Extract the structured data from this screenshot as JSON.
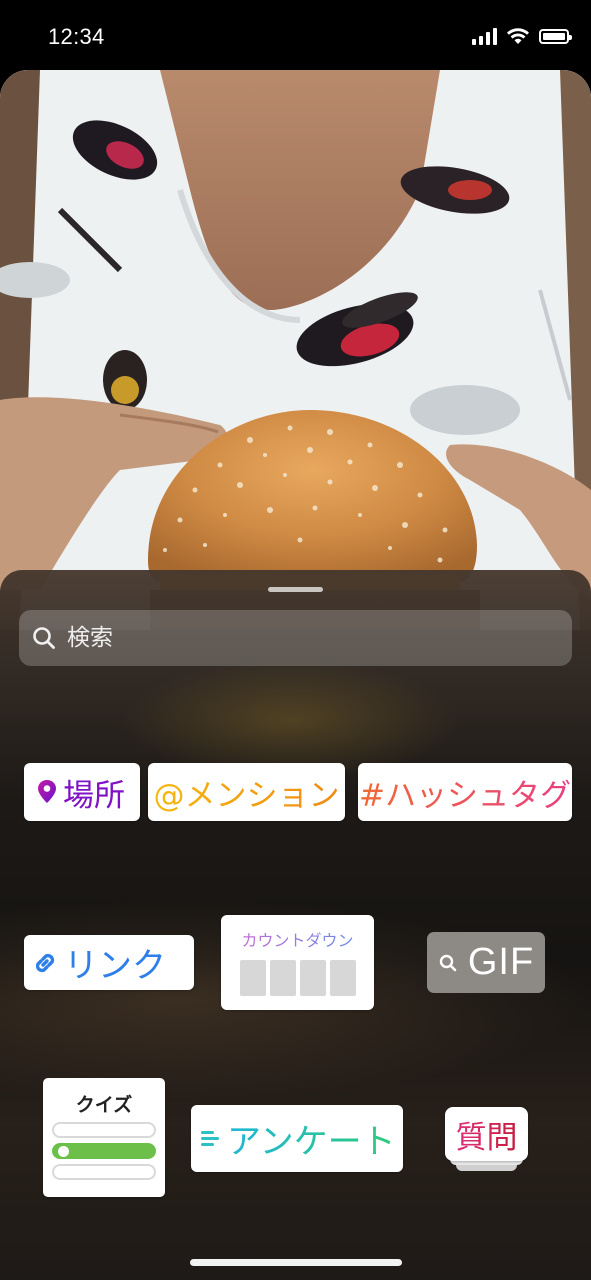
{
  "status_bar": {
    "time": "12:34",
    "icons": [
      "signal-icon",
      "wifi-icon",
      "battery-icon"
    ]
  },
  "photo": {
    "subject": "hands-holding-burger-bun"
  },
  "sheet": {
    "search": {
      "placeholder": "検索",
      "icon": "search-icon"
    },
    "stickers": {
      "location": {
        "label": "場所",
        "icon": "location-pin-icon",
        "color": "#7f12c4"
      },
      "mention": {
        "label": "@メンション",
        "colors": [
          "#f5b80f",
          "#f08a15"
        ]
      },
      "hashtag": {
        "label": "#ハッシュタグ",
        "colors": [
          "#f06a33",
          "#e83f84"
        ]
      },
      "link": {
        "label": "リンク",
        "icon": "link-icon",
        "color": "#2f7fe8"
      },
      "countdown": {
        "title": "カウントダウン"
      },
      "gif": {
        "label": "GIF",
        "icon": "search-icon"
      },
      "quiz": {
        "title": "クイズ"
      },
      "poll": {
        "label": "アンケート",
        "icon": "poll-lines-icon"
      },
      "question": {
        "label": "質問"
      }
    }
  }
}
